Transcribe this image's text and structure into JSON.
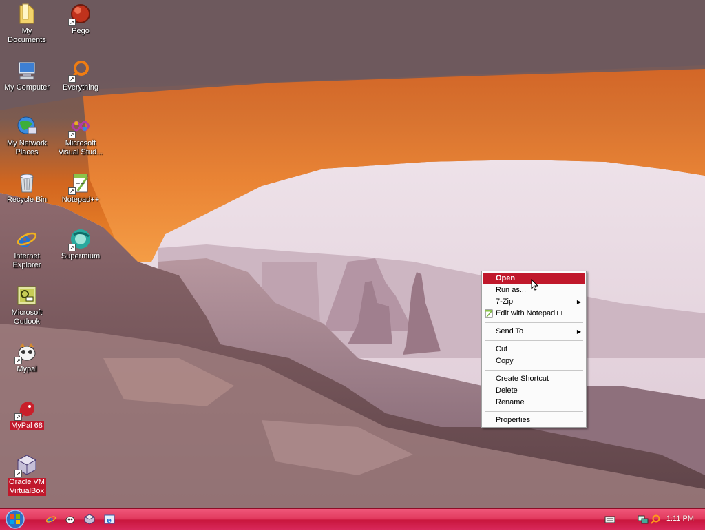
{
  "desktop_icons": [
    {
      "name": "My\nDocuments",
      "label1": "My",
      "label2": "Documents",
      "icon": "folder-icon"
    },
    {
      "label1": "Pego",
      "label2": "",
      "icon": "pego-icon",
      "shortcut": true
    },
    {
      "label1": "My Computer",
      "label2": "",
      "icon": "computer-icon"
    },
    {
      "label1": "Everything",
      "label2": "",
      "icon": "everything-icon",
      "shortcut": true
    },
    {
      "label1": "My Network",
      "label2": "Places",
      "icon": "network-icon"
    },
    {
      "label1": "Microsoft",
      "label2": "Visual Stud...",
      "icon": "visual-studio-icon",
      "shortcut": true
    },
    {
      "label1": "Recycle Bin",
      "label2": "",
      "icon": "recycle-bin-icon"
    },
    {
      "label1": "Notepad++",
      "label2": "",
      "icon": "notepad-plus-plus-icon",
      "shortcut": true
    },
    {
      "label1": "Internet",
      "label2": "Explorer",
      "icon": "internet-explorer-icon"
    },
    {
      "label1": "Supermium",
      "label2": "",
      "icon": "supermium-icon",
      "shortcut": true
    },
    {
      "label1": "Microsoft",
      "label2": "Outlook",
      "icon": "outlook-icon"
    },
    {
      "label1": "Mypal",
      "label2": "",
      "icon": "mypal-icon",
      "shortcut": true
    },
    {
      "label1": "MyPal 68",
      "label2": "",
      "icon": "mypal68-icon",
      "shortcut": true
    },
    {
      "label1": "Oracle VM",
      "label2": "VirtualBox",
      "icon": "virtualbox-icon",
      "shortcut": true
    }
  ],
  "context_menu": {
    "open": "Open",
    "run_as": "Run as...",
    "seven_zip": "7-Zip",
    "edit_notepad": "Edit with Notepad++",
    "send_to": "Send To",
    "cut": "Cut",
    "copy": "Copy",
    "create_shortcut": "Create Shortcut",
    "delete": "Delete",
    "rename": "Rename",
    "properties": "Properties"
  },
  "taskbar": {
    "clock": "1:11 PM",
    "quick_launch": [
      "internet-explorer-icon",
      "mypal-icon",
      "virtualbox-icon",
      "ie-alt-icon"
    ],
    "tray": [
      "keyboard-icon",
      "network-tray-icon",
      "everything-tray-icon"
    ]
  },
  "colors": {
    "accent": "#c0182b",
    "taskbar": "#e23b5f"
  }
}
